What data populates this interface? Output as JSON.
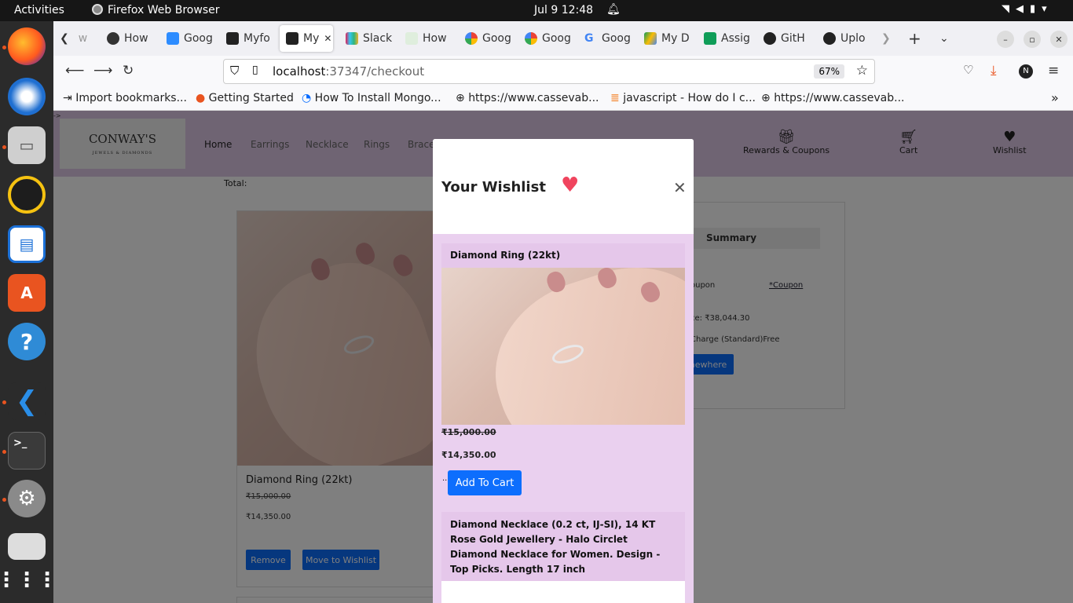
{
  "system": {
    "activities": "Activities",
    "app_name": "Firefox Web Browser",
    "clock": "Jul 9  12:48"
  },
  "dock": {
    "items": [
      "firefox-icon",
      "thunderbird-icon",
      "files-icon",
      "rhythmbox-icon",
      "writer-icon",
      "software-icon",
      "help-icon",
      "vscode-icon",
      "terminal-icon",
      "settings-icon",
      "disk-icon",
      "apps-grid-icon"
    ]
  },
  "browser": {
    "tabs": [
      {
        "label": "w",
        "icon_color": "#888888"
      },
      {
        "label": "How",
        "icon_color": "#333333"
      },
      {
        "label": "Goog",
        "icon_color": "#2d8cff"
      },
      {
        "label": "Myfo",
        "icon_color": "#222222"
      },
      {
        "label": "My",
        "icon_color": "#222222"
      },
      {
        "label": "Slack",
        "icon_color": "#e01e5a"
      },
      {
        "label": "How",
        "icon_color": "#5fa35f"
      },
      {
        "label": "Goog",
        "icon_color": "#ea4335"
      },
      {
        "label": "Goog",
        "icon_color": "#ea4335"
      },
      {
        "label": "Goog",
        "icon_color": "#4285f4"
      },
      {
        "label": "My D",
        "icon_color": "#fbbc04"
      },
      {
        "label": "Assig",
        "icon_color": "#0f9d58"
      },
      {
        "label": "GitH",
        "icon_color": "#222222"
      },
      {
        "label": "Uplo",
        "icon_color": "#222222"
      }
    ],
    "url_host": "localhost",
    "url_rest": ":37347/checkout",
    "zoom": "67%",
    "bookmarks": [
      "Import bookmarks...",
      "Getting Started",
      "How To Install Mongo...",
      "https://www.cassevab...",
      "javascript - How do I c...",
      "https://www.cassevab..."
    ]
  },
  "site": {
    "logo": "CONWAY'S",
    "logo_sub": "JEWELS & DIAMONDS",
    "nav": [
      "Home",
      "Earrings",
      "Necklace",
      "Rings",
      "Brace"
    ],
    "rewards_label": "Rewards & Coupons",
    "cart_label": "Cart",
    "wishlist_label": "Wishlist",
    "total_label": "Total:",
    "product": {
      "name": "Diamond Ring (22kt)",
      "old_price": "₹15,000.00",
      "new_price": "₹14,350.00",
      "remove_label": "Remove",
      "move_label": "Move to Wishlist"
    },
    "summary": {
      "title": "Summary",
      "coupon": "oupon",
      "coupon_link": "*Coupon",
      "price": "ce: ₹38,044.30",
      "charge": "Charge (Standard)Free",
      "button": "newhere"
    }
  },
  "modal": {
    "title": "Your Wishlist",
    "items": [
      {
        "title": "Diamond Ring (22kt)",
        "old_price": "₹15,000.00",
        "new_price": "₹14,350.00",
        "button": "Add To Cart"
      },
      {
        "title": "Diamond Necklace (0.2 ct, IJ-SI), 14 KT Rose Gold Jewellery - Halo Circlet Diamond Necklace for Women. Design - Top Picks. Length 17 inch"
      }
    ]
  },
  "colors": {
    "accent": "#0d6efd",
    "header_bg": "#dfc9e6",
    "modal_body": "#ead0ef",
    "heart": "#f0445e"
  }
}
